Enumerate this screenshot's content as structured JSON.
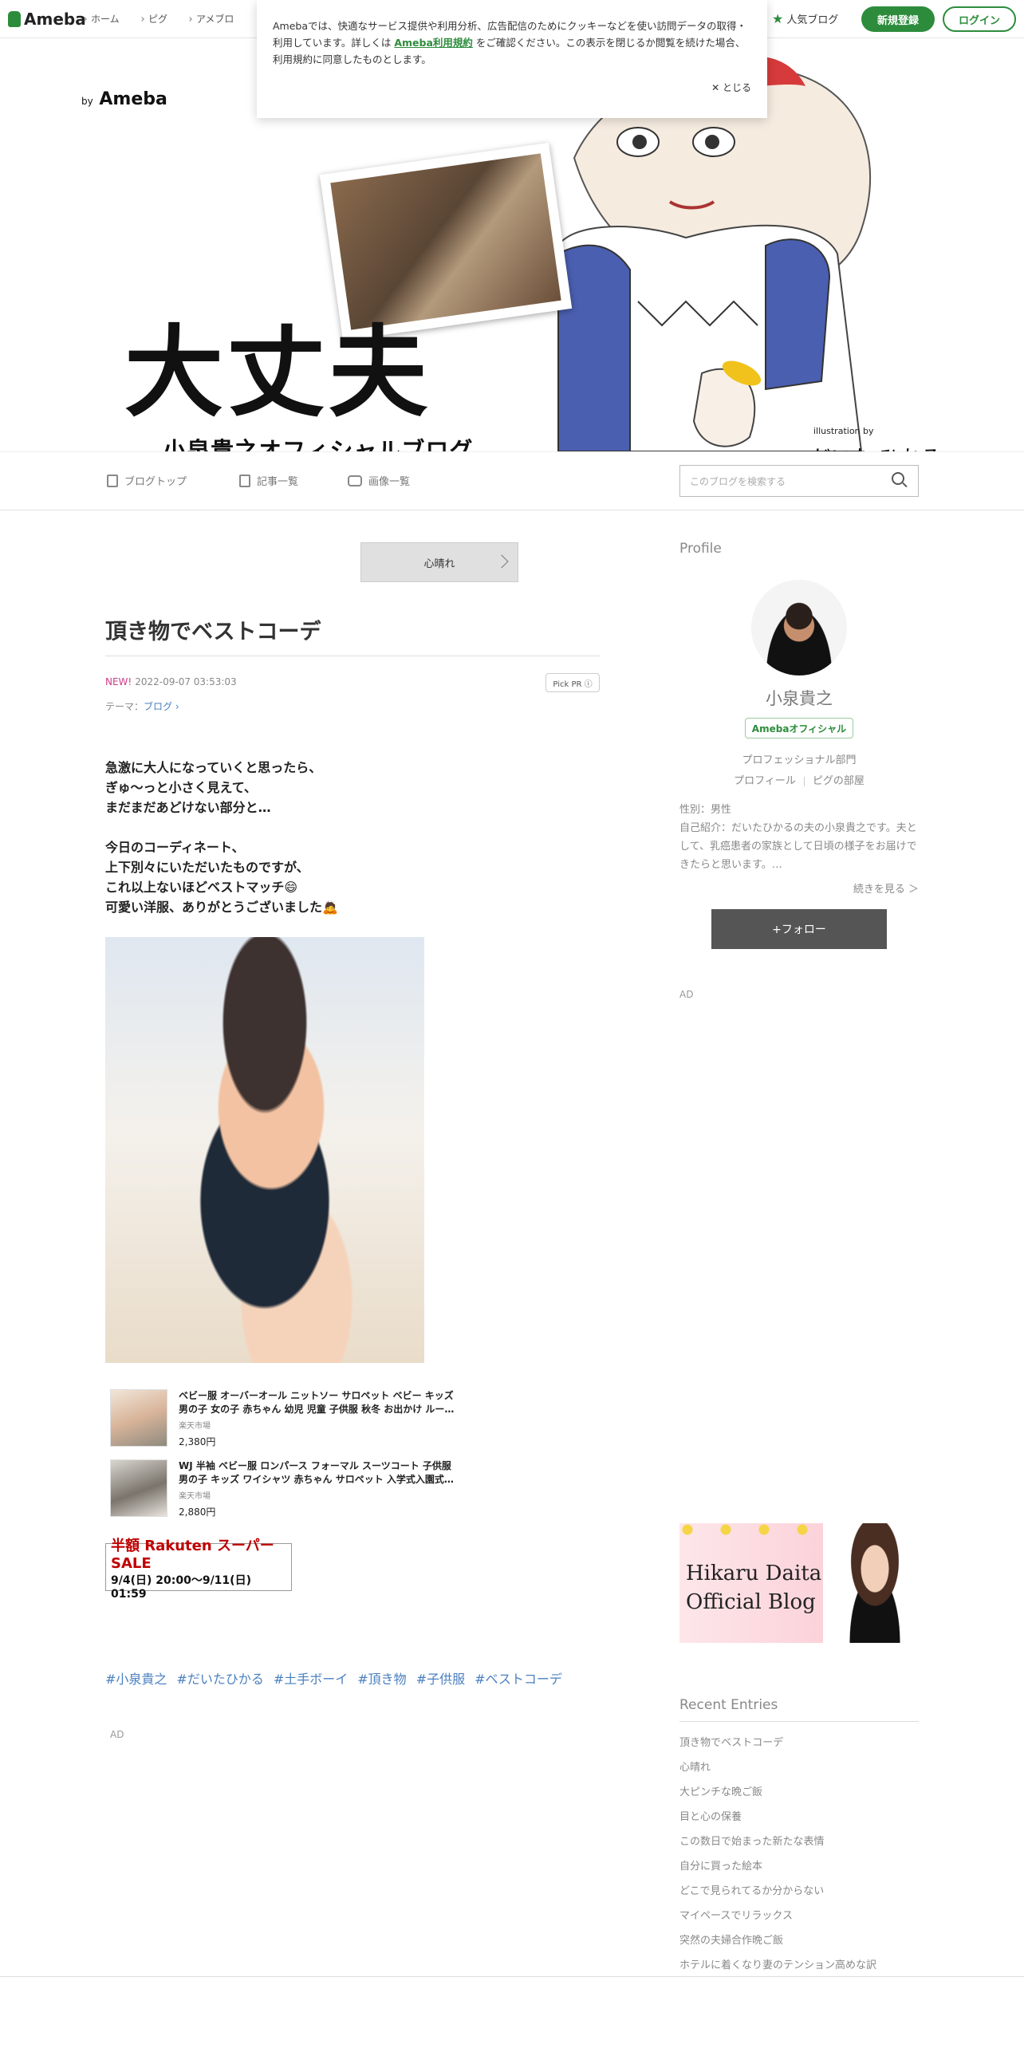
{
  "topbar": {
    "logo": "Ameba",
    "nav": [
      "ホーム",
      "ピグ",
      "アメブロ"
    ],
    "popular": "人気ブログ",
    "signup": "新規登録",
    "login": "ログイン"
  },
  "cookie": {
    "text_before": "Amebaでは、快適なサービス提供や利用分析、広告配信のためにクッキーなどを使い訪問データの取得・利用しています。詳しくは ",
    "link": "Ameba利用規約",
    "text_after": " をご確認ください。この表示を閉じるか閲覧を続けた場合、利用規約に同意したものとします。",
    "close": "✕ とじる"
  },
  "header": {
    "by": "by",
    "brand": "Ameba",
    "title": "大丈夫",
    "subtitle": "小泉貴之オフィシャルブログ",
    "illus_by": "illustration by",
    "illus_name": "だいた ひかる"
  },
  "blognav": {
    "top": "ブログトップ",
    "articles": "記事一覧",
    "images": "画像一覧",
    "search_placeholder": "このブログを検索する"
  },
  "article": {
    "prev": "心晴れ",
    "title": "頂き物でベストコーデ",
    "new": "NEW!",
    "date": "2022-09-07 03:53:03",
    "pickpr": "Pick PR ⓘ",
    "theme_label": "テーマ：",
    "theme": "ブログ ›",
    "paragraphs": [
      [
        "急激に大人になっていくと思ったら、",
        "ぎゅ〜っと小さく見えて、",
        "まだまだあどけない部分と…"
      ],
      [
        "今日のコーディネート、",
        "上下別々にいただいたものですが、",
        "これ以上ないほどベストマッチ😄",
        "可愛い洋服、ありがとうございました🙇"
      ]
    ],
    "products": [
      {
        "name1": "ベビー服 オーバーオール ニットソー サロペット ベビー キッズ",
        "name2": "男の子 女の子 赤ちゃん 幼児 児童 子供服 秋冬 お出かけ ルー…",
        "shop": "楽天市場",
        "price": "2,380円"
      },
      {
        "name1": "WJ 半袖 ベビー服 ロンパース フォーマル スーツコート 子供服",
        "name2": "男の子 キッズ ワイシャツ 赤ちゃん サロペット 入学式入園式…",
        "shop": "楽天市場",
        "price": "2,880円"
      }
    ],
    "sale_line1": "半額 Rakuten スーパーSALE",
    "sale_line2": "9/4(日) 20:00〜9/11(日) 01:59",
    "hashtags": [
      "#小泉貴之",
      "#だいたひかる",
      "#土手ボーイ",
      "#頂き物",
      "#子供服",
      "#ベストコーデ"
    ],
    "ad": "AD"
  },
  "sidebar": {
    "profile_heading": "Profile",
    "name": "小泉貴之",
    "badge": "Amebaオフィシャル",
    "dept": "プロフェッショナル部門",
    "link_profile": "プロフィール",
    "link_pig": "ピグの部屋",
    "gender": "性別：男性",
    "intro": "自己紹介：だいたひかるの夫の小泉貴之です。夫として、乳癌患者の家族として日頃の様子をお届けできたらと思います。…",
    "more": "続きを見る ＞",
    "follow": "+フォロー",
    "ad": "AD",
    "banner_line1": "Hikaru Daita",
    "banner_line2": "Official Blog",
    "recent_heading": "Recent Entries",
    "recent": [
      "頂き物でベストコーデ",
      "心晴れ",
      "大ピンチな晩ご飯",
      "目と心の保養",
      "この数日で始まった新たな表情",
      "自分に買った絵本",
      "どこで見られてるか分からない",
      "マイペースでリラックス",
      "突然の夫婦合作晩ご飯",
      "ホテルに着くなり妻のテンション高めな訳"
    ]
  }
}
